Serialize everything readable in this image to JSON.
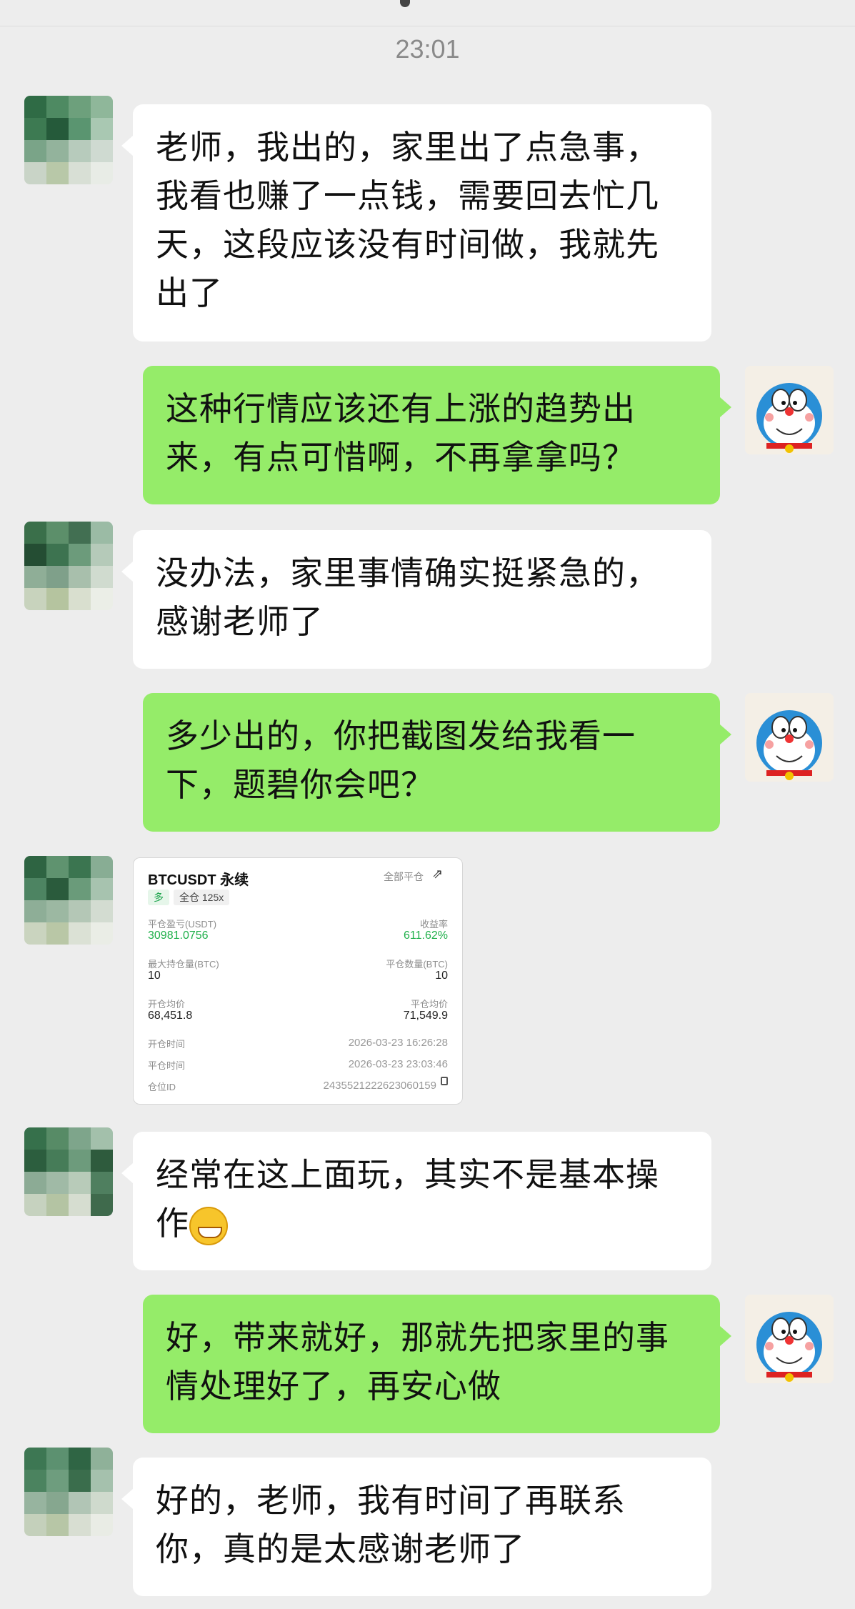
{
  "chat": {
    "timestamp": "23:01",
    "messages": [
      {
        "side": "left",
        "text": "老师，我出的，家里出了点急事，我看也赚了一点钱，需要回去忙几天，这段应该没有时间做，我就先出了"
      },
      {
        "side": "right",
        "text": "这种行情应该还有上涨的趋势出来，有点可惜啊，不再拿拿吗？"
      },
      {
        "side": "left",
        "text": "没办法，家里事情确实挺紧急的，感谢老师了"
      },
      {
        "side": "right",
        "text": "多少出的，你把截图发给我看一下，题碧你会吧？"
      },
      {
        "side": "left",
        "type": "image-card"
      },
      {
        "side": "left",
        "text": "经常在这上面玩，其实不是基本操作",
        "emoji": "grinning-face-emoji"
      },
      {
        "side": "right",
        "text": "好，带来就好，那就先把家里的事情处理好了，再安心做"
      },
      {
        "side": "left",
        "text": "好的，老师，我有时间了再联系你，真的是太感谢老师了"
      }
    ]
  },
  "card": {
    "title": "BTCUSDT 永续",
    "close_all": "全部平仓",
    "share_icon": "share-icon",
    "side_tag": "多",
    "leverage_tag": "全仓 125x",
    "pnl_label": "平仓盈亏(USDT)",
    "pnl_value": "30981.0756",
    "roi_label": "收益率",
    "roi_value": "611.62%",
    "max_pos_label": "最大持仓量(BTC)",
    "max_pos_value": "10",
    "close_qty_label": "平仓数量(BTC)",
    "close_qty_value": "10",
    "open_avg_label": "开仓均价",
    "open_avg_value": "68,451.8",
    "close_avg_label": "平仓均价",
    "close_avg_value": "71,549.9",
    "open_time_label": "开仓时间",
    "open_time_value": "2026-03-23 16:26:28",
    "close_time_label": "平仓时间",
    "close_time_value": "2026-03-23 23:03:46",
    "position_id_label": "仓位ID",
    "position_id_value": "2435521222623060159",
    "copy_icon": "copy-icon"
  },
  "colors": {
    "background": "#ededed",
    "bubble_left": "#ffffff",
    "bubble_right": "#95ec69",
    "profit_green": "#20b04b"
  }
}
